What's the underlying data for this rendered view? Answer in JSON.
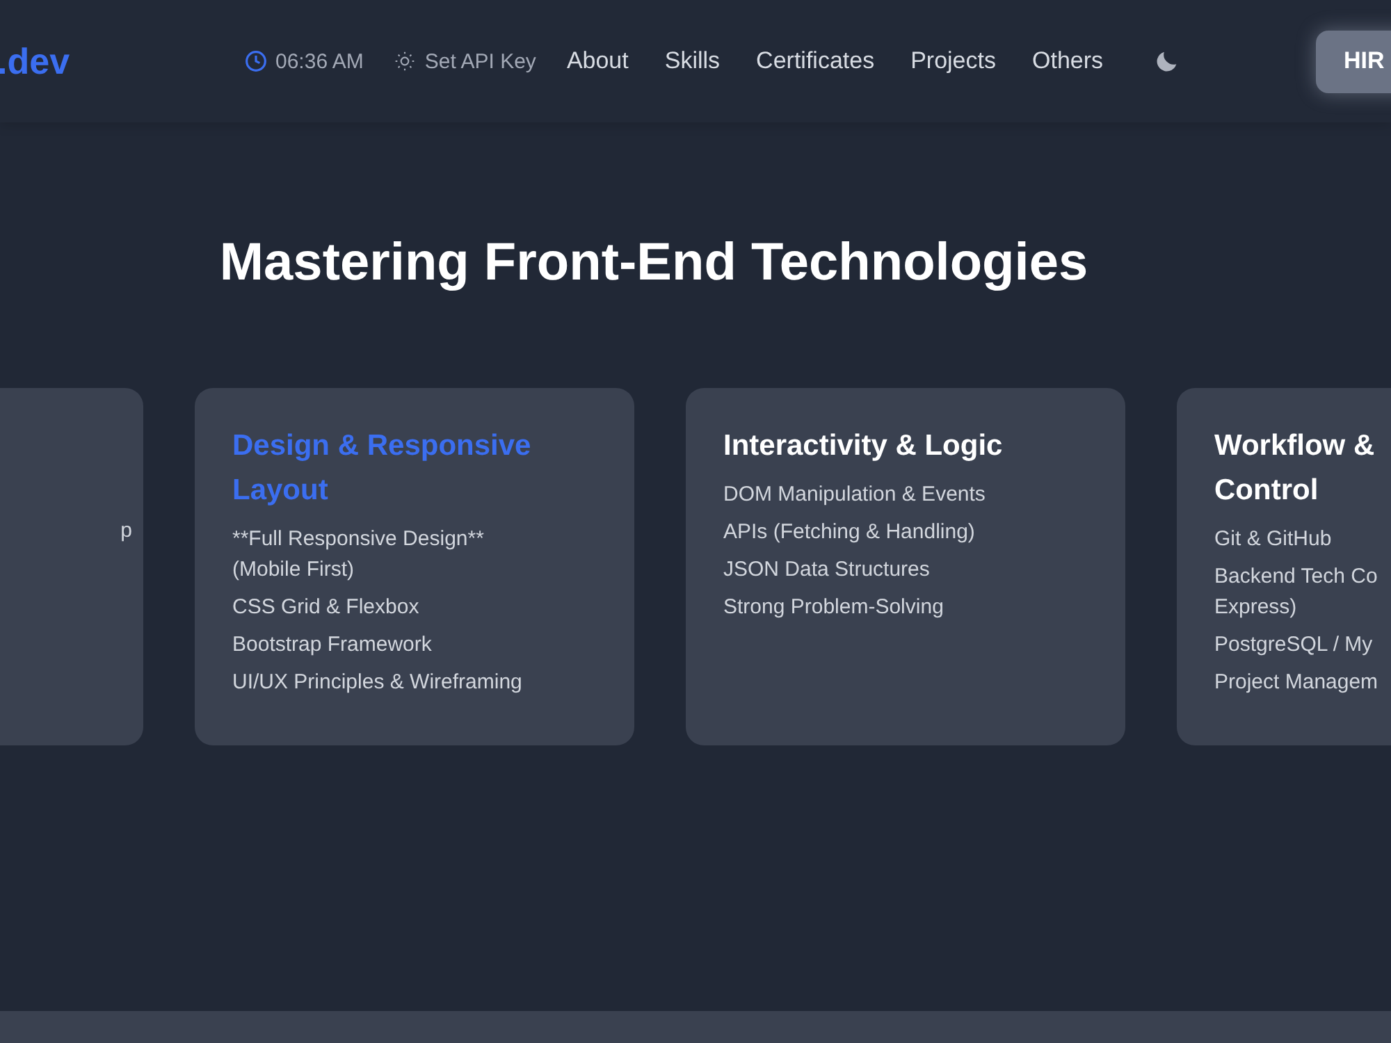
{
  "header": {
    "logo": ".dev",
    "time": "06:36 AM",
    "api_key": "Set API Key",
    "nav": [
      {
        "label": "About"
      },
      {
        "label": "Skills"
      },
      {
        "label": "Certificates"
      },
      {
        "label": "Projects"
      },
      {
        "label": "Others"
      }
    ],
    "hire_button": "HIR"
  },
  "section": {
    "title": "Mastering Front-End Technologies",
    "cards": [
      {
        "items": [
          [
            "p"
          ]
        ]
      },
      {
        "title_lines": [
          "Design & Responsive",
          "Layout"
        ],
        "highlighted": true,
        "items": [
          [
            "**Full Responsive Design**",
            "(Mobile First)"
          ],
          [
            "CSS Grid & Flexbox"
          ],
          [
            "Bootstrap Framework"
          ],
          [
            "UI/UX Principles & Wireframing"
          ]
        ]
      },
      {
        "title_lines": [
          "Interactivity & Logic"
        ],
        "highlighted": false,
        "items": [
          [
            "DOM Manipulation & Events"
          ],
          [
            "APIs (Fetching & Handling)"
          ],
          [
            "JSON Data Structures"
          ],
          [
            "Strong Problem-Solving"
          ]
        ]
      },
      {
        "title_lines": [
          "Workflow &",
          "Control"
        ],
        "highlighted": false,
        "items": [
          [
            "Git & GitHub"
          ],
          [
            "Backend Tech Co",
            "Express)"
          ],
          [
            "PostgreSQL / My"
          ],
          [
            "Project Managem"
          ]
        ]
      }
    ]
  }
}
